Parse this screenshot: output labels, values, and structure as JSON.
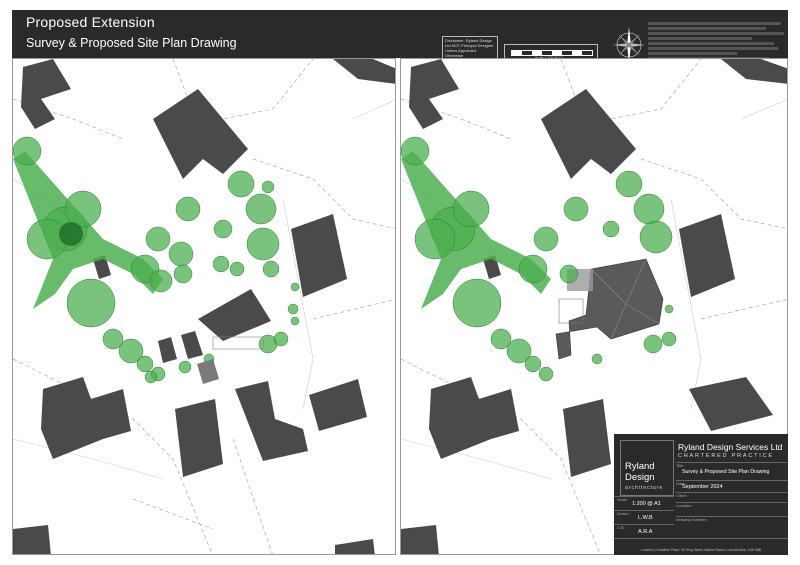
{
  "header": {
    "title_line1": "Proposed Extension",
    "title_line2": "Survey & Proposed Site Plan Drawing",
    "disclaimer": "Disclaimer: Ryland Design Ltd NOT Principal Designer Unless Appointed Otherwise",
    "scale_label": "Scale 1:200 @ A1"
  },
  "title_block": {
    "logo_line1": "Ryland",
    "logo_line2": "Design",
    "logo_line3": "architecture",
    "company": "Ryland Design Services Ltd",
    "practice": "CHARTERED PRACTICE",
    "title_label": "Title :",
    "title_value": "Survey & Proposed Site Plan Drawing",
    "date_label": "Date :",
    "date_value": "September 2024",
    "client_label": "Client :",
    "location_label": "Location :",
    "scale_label": "Scale :",
    "scale_value": "1:200 @ A1",
    "drawn_label": "Drawn :",
    "drawn_value": "L.W.B",
    "checked_label": "C.B. :",
    "checked_value": "A.R.A",
    "drawing_number_label": "Drawing Number :",
    "address": "Location | Hamilton Place, 30 King Street, Market Rasen, Lincolnshire, LN8 3BB"
  },
  "colors": {
    "frame": "#2a2a2a",
    "building": "#4a4a4a",
    "tree": "#4caf50",
    "tree_dark": "#1e6b2a",
    "extension": "#7a7a7a"
  }
}
